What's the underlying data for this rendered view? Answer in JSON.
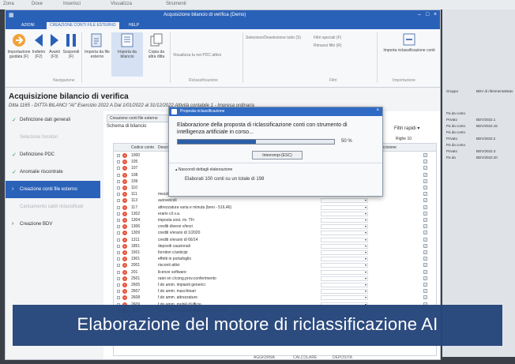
{
  "desktop": {
    "top_labels": [
      "Zona",
      "Dove",
      "Inserisci",
      "Visualizza",
      "Strumenti"
    ]
  },
  "window": {
    "title": "Acquisizione bilancio di verifica (Demo)",
    "menu": [
      "AZIONI",
      "CREAZIONE CONTI FILE ESTERNO",
      "HELP"
    ],
    "active_menu_index": 1
  },
  "ribbon": {
    "buttons": [
      {
        "label": "Importazione guidata (F)",
        "icon": "import-icon"
      },
      {
        "label": "Indietro (F2)",
        "icon": "back-arrow-icon"
      },
      {
        "label": "Avanti (F3)",
        "icon": "forward-arrow-icon"
      },
      {
        "label": "Sospendi (F)",
        "icon": "pause-icon"
      },
      {
        "label": "Importa da file esterno",
        "icon": "file-import-icon"
      },
      {
        "label": "Importa da bilancio",
        "icon": "balance-import-icon"
      },
      {
        "label": "Copia da altra ditta",
        "icon": "copy-icon"
      }
    ],
    "small_items": [
      "Visualizza tu nei PDC attivo",
      "Selezione/Deselezione tutto (S)",
      "Filtri speciali (F)",
      "Rimuovi filtri (R)",
      "Importa riclassificazione conti"
    ],
    "groups": [
      "Navigazione",
      "Riclassificazione",
      "Filtri",
      "Importazione"
    ]
  },
  "page": {
    "title": "Acquisizione bilancio di verifica",
    "subtitle": "Ditta 1165 - DITTA BILANCI \"AI\"   Esercizio 2022 A   Dal 1/01/2022 al 31/12/2022   Attività contabile 1 - Impresa ordinaria"
  },
  "sidebar": {
    "items": [
      {
        "label": "Definizione dati generali",
        "state": "done"
      },
      {
        "label": "Selezione fornitori",
        "state": "disabled"
      },
      {
        "label": "Definizione PDC",
        "state": "done"
      },
      {
        "label": "Anomalie riscontrate",
        "state": "done"
      },
      {
        "label": "Creazione conti file esterno",
        "state": "active"
      },
      {
        "label": "Caricamento saldi riclassificati",
        "state": "disabled"
      },
      {
        "label": "Creazione BDV",
        "state": "normal"
      }
    ]
  },
  "content": {
    "tab_label": "Creazione conti file esterno",
    "schema_label": "Schema di bilancio",
    "filters_label": "Filtri rapidi",
    "righe_label": "Righe 10",
    "columns": [
      "Codice conto",
      "Descrizione",
      "Decisione"
    ],
    "rows": [
      {
        "code": "1000",
        "desc": ""
      },
      {
        "code": "105",
        "desc": ""
      },
      {
        "code": "107",
        "desc": ""
      },
      {
        "code": "108",
        "desc": ""
      },
      {
        "code": "109",
        "desc": ""
      },
      {
        "code": "110",
        "desc": ""
      },
      {
        "code": "111",
        "desc": "mezzi di trasporto interni"
      },
      {
        "code": "113",
        "desc": "autoveicoli"
      },
      {
        "code": "117",
        "desc": "attrezzatura varia e minuta (beni - 516,46)"
      },
      {
        "code": "1302",
        "desc": "erario c/i.v.a."
      },
      {
        "code": "1304",
        "desc": "imposta sost. riv. TFr"
      },
      {
        "code": "1306",
        "desc": "crediti diversi v/terzi"
      },
      {
        "code": "1309",
        "desc": "crediti v/erario dl 1/2020"
      },
      {
        "code": "1311",
        "desc": "crediti v/erario dl 66/14"
      },
      {
        "code": "1851",
        "desc": "depositi cauzionali"
      },
      {
        "code": "1501",
        "desc": "fornitori c/anticipi"
      },
      {
        "code": "1901",
        "desc": "effetti in portafoglio"
      },
      {
        "code": "2001",
        "desc": "risconti attivi"
      },
      {
        "code": "201",
        "desc": "licenze software"
      },
      {
        "code": "2501",
        "desc": "ratei on c/cong.prov.conferimento"
      },
      {
        "code": "2605",
        "desc": "f.do amm. impianti generici"
      },
      {
        "code": "2607",
        "desc": "f.do amm. macchinari"
      },
      {
        "code": "2608",
        "desc": "f.do amm. attrezzature"
      },
      {
        "code": "2609",
        "desc": "f.do amm. mobili d'ufficio"
      },
      {
        "code": "2610",
        "desc": "f.do amm. macch.d'ufficio/cont.ed elettr."
      }
    ],
    "bottom_buttons": [
      "AGGIORNA",
      "CALCOLARE",
      "DEPOSITA"
    ]
  },
  "dialog": {
    "title": "Proposta riclassificazione",
    "message": "Elaborazione della proposta di riclassificazione conti con strumento di intelligenza artificiale in corso...",
    "progress_percent": 50,
    "progress_text": "50 %",
    "abort_label": "Interrompi (ESC)",
    "details_label": "Nascondi dettagli elaborazione",
    "detail_text": "Elaborati 100 conti su un totale di 198"
  },
  "right_pane": {
    "headers": [
      "Gruppo",
      "BDV di riferimento",
      "Stato"
    ],
    "rows": [
      {
        "a": "Pa da conto",
        "b": "",
        "c": ""
      },
      {
        "a": "Privato",
        "b": "BDV/2022.1",
        "c": ""
      },
      {
        "a": "Pa da conto",
        "b": "BDV/2022.16",
        "c": ""
      },
      {
        "a": "Pa da conto",
        "b": "",
        "c": ""
      },
      {
        "a": "Privato",
        "b": "BDV/2022.2",
        "c": ""
      },
      {
        "a": "Pa da conto",
        "b": "",
        "c": ""
      },
      {
        "a": "Privato",
        "b": "BDV/2022.3",
        "c": ""
      },
      {
        "a": "Pa da",
        "b": "BDV/2022.20",
        "c": ""
      }
    ]
  },
  "caption": "Elaborazione del motore di riclassificazione AI"
}
